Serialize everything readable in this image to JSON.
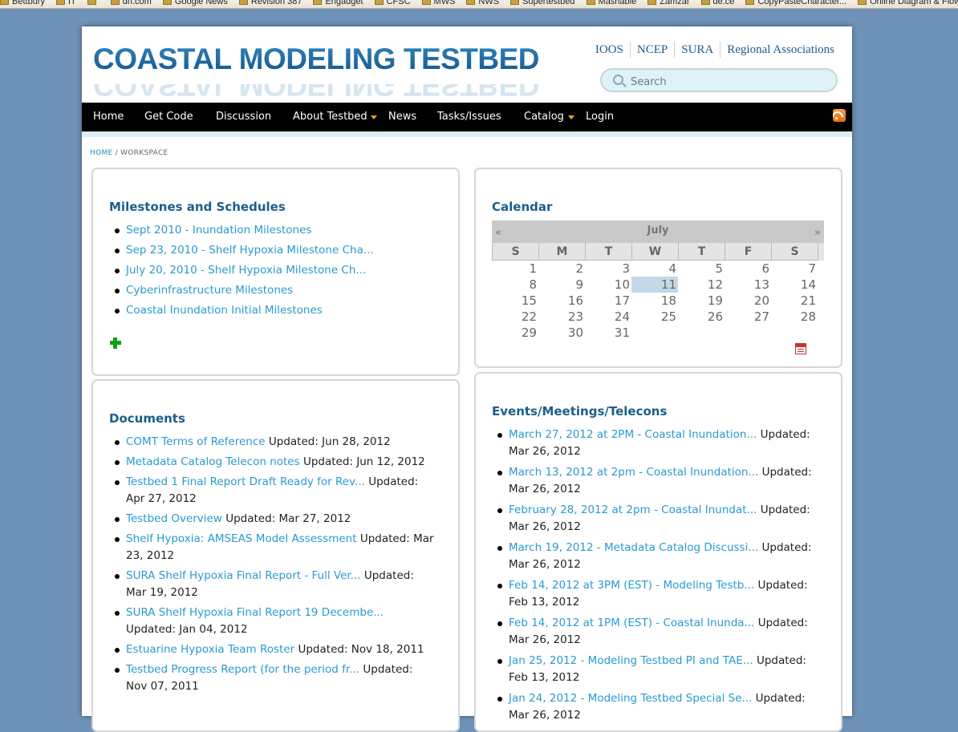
{
  "bookmarks": [
    "Bettbury",
    "IT",
    "",
    "dn.com",
    "Google News",
    "Revision 387",
    "Engadget",
    "CFSC",
    "MWS",
    "NWS",
    "Supertestbed",
    "Mashable",
    "Zamzar",
    "de.ce",
    "CopyPasteCharacter...",
    "Online Diagram & Flow..."
  ],
  "site": {
    "logo_text": "COASTAL MODELING TESTBED",
    "partners": [
      "IOOS",
      "NCEP",
      "SURA",
      "Regional Associations"
    ],
    "search_placeholder": "Search"
  },
  "nav": {
    "items": [
      "Home",
      "Get Code",
      "Discussion",
      "About Testbed",
      "News",
      "Tasks/Issues",
      "Catalog",
      "Login"
    ]
  },
  "breadcrumb": {
    "home": "HOME",
    "separator": " / ",
    "current": "WORKSPACE"
  },
  "milestones": {
    "title": "Milestones and Schedules",
    "items": [
      "Sept 2010 - Inundation Milestones",
      "Sep 23, 2010 - Shelf Hypoxia Milestone Cha...",
      "July 20, 2010 - Shelf Hypoxia Milestone Ch...",
      "Cyberinfrastructure Milestones",
      "Coastal Inundation Initial Milestones"
    ]
  },
  "calendar": {
    "title": "Calendar",
    "month": "July",
    "prev": "«",
    "next": "»",
    "weekdays": [
      "S",
      "M",
      "T",
      "W",
      "T",
      "F",
      "S"
    ],
    "weeks": [
      [
        "1",
        "2",
        "3",
        "4",
        "5",
        "6",
        "7"
      ],
      [
        "8",
        "9",
        "10",
        "11",
        "12",
        "13",
        "14"
      ],
      [
        "15",
        "16",
        "17",
        "18",
        "19",
        "20",
        "21"
      ],
      [
        "22",
        "23",
        "24",
        "25",
        "26",
        "27",
        "28"
      ],
      [
        "29",
        "30",
        "31",
        "",
        "",
        "",
        ""
      ]
    ],
    "today": "11"
  },
  "documents": {
    "title": "Documents",
    "items": [
      {
        "link": "COMT Terms of Reference",
        "updated": "Updated: Jun 28, 2012"
      },
      {
        "link": "Metadata Catalog Telecon notes",
        "updated": "Updated: Jun 12, 2012"
      },
      {
        "link": "Testbed 1 Final Report Draft Ready for Rev...",
        "updated": "Updated: Apr 27, 2012"
      },
      {
        "link": "Testbed Overview",
        "updated": "Updated: Mar 27, 2012"
      },
      {
        "link": "Shelf Hypoxia: AMSEAS Model Assessment",
        "updated": "Updated: Mar 23, 2012"
      },
      {
        "link": "SURA Shelf Hypoxia Final Report - Full Ver...",
        "updated": "Updated: Mar 19, 2012"
      },
      {
        "link": "SURA Shelf Hypoxia Final Report 19 Decembe...",
        "updated": "Updated: Jan 04, 2012"
      },
      {
        "link": "Estuarine Hypoxia Team Roster",
        "updated": "Updated: Nov 18, 2011"
      },
      {
        "link": "Testbed Progress Report (for the period fr...",
        "updated": "Updated: Nov 07, 2011"
      }
    ]
  },
  "events": {
    "title": "Events/Meetings/Telecons",
    "items": [
      {
        "link": "March 27, 2012 at 2PM - Coastal Inundation...",
        "updated": "Updated: Mar 26, 2012"
      },
      {
        "link": "March 13, 2012 at 2pm - Coastal Inundation...",
        "updated": "Updated: Mar 26, 2012"
      },
      {
        "link": "February 28, 2012 at 2pm - Coastal Inundat...",
        "updated": "Updated: Mar 26, 2012"
      },
      {
        "link": "March 19, 2012 - Metadata Catalog Discussi...",
        "updated": "Updated: Mar 26, 2012"
      },
      {
        "link": "Feb 14, 2012 at 3PM (EST) - Modeling Testb...",
        "updated": "Updated: Feb 13, 2012"
      },
      {
        "link": "Feb 14, 2012 at 1PM (EST) - Coastal Inunda...",
        "updated": "Updated: Mar 26, 2012"
      },
      {
        "link": "Jan 25, 2012 - Modeling Testbed PI and TAE...",
        "updated": "Updated: Feb 13, 2012"
      },
      {
        "link": "Jan 24, 2012 - Modeling Testbed Special Se...",
        "updated": "Updated: Mar 26, 2012"
      }
    ]
  },
  "colors": {
    "background": "#6f92b8",
    "nav": "#000000",
    "link": "#2a9ad1",
    "heading": "#1d5e8a",
    "add_icon": "#12a012"
  }
}
